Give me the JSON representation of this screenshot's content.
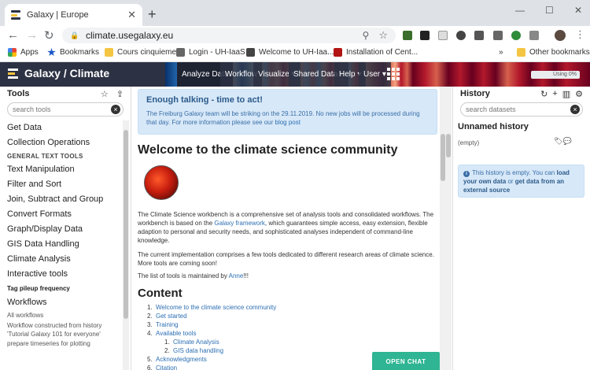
{
  "browser": {
    "tab_title": "Galaxy | Europe",
    "url": "climate.usegalaxy.eu",
    "bookmarks": [
      "Apps",
      "Bookmarks",
      "Cours cinquieme",
      "Login - UH-IaaS",
      "Welcome to UH-Iaa...",
      "Installation of Cent...",
      "»",
      "Other bookmarks"
    ]
  },
  "masthead": {
    "brand": "Galaxy / Climate",
    "nav": [
      "Analyze Data",
      "Workflow",
      "Visualize ▾",
      "Shared Data ▾",
      "Help ▾",
      "User ▾"
    ],
    "quota": "Using 0%"
  },
  "tools": {
    "title": "Tools",
    "search_placeholder": "search tools",
    "items": [
      {
        "label": "Get Data",
        "kind": "tool"
      },
      {
        "label": "Collection Operations",
        "kind": "tool"
      },
      {
        "label": "GENERAL TEXT TOOLS",
        "kind": "section"
      },
      {
        "label": "Text Manipulation",
        "kind": "tool"
      },
      {
        "label": "Filter and Sort",
        "kind": "tool"
      },
      {
        "label": "Join, Subtract and Group",
        "kind": "tool"
      },
      {
        "label": "Convert Formats",
        "kind": "tool"
      },
      {
        "label": "Graph/Display Data",
        "kind": "tool"
      },
      {
        "label": "GIS Data Handling",
        "kind": "tool"
      },
      {
        "label": "Climate Analysis",
        "kind": "tool"
      },
      {
        "label": "Interactive tools",
        "kind": "tool"
      },
      {
        "label": "Tag pileup frequency",
        "kind": "bold8"
      },
      {
        "label": "Workflows",
        "kind": "tool"
      },
      {
        "label": "All workflows",
        "kind": "small"
      },
      {
        "label": "Workflow constructed from history",
        "kind": "small2"
      },
      {
        "label": "'Tutorial Galaxy 101 for everyone'",
        "kind": "small2"
      },
      {
        "label": "prepare timeseries for plotting",
        "kind": "small"
      }
    ]
  },
  "center": {
    "alert_title": "Enough talking - time to act!",
    "alert_body_1": "The Freiburg Galaxy team will be striking on the 29.11.2019. No new jobs will be processed during that day. For more information please see our ",
    "alert_link": "blog post",
    "heading": "Welcome to the climate science community",
    "p1_a": "The Climate Science workbench is a comprehensive set of analysis tools and consolidated workflows. The workbench is based on the ",
    "p1_link": "Galaxy framework",
    "p1_b": ", which guarantees simple access, easy extension, flexible adaption to personal and security needs, and sophisticated analyses independent of command-line knowledge.",
    "p2": "The current implementation comprises a few tools dedicated to different research areas of climate science. More tools are coming soon!",
    "p3_a": "The list of tools is maintained by ",
    "p3_link": "Anne",
    "p3_b": "!!!",
    "content_heading": "Content",
    "toc": [
      {
        "n": "1.",
        "label": "Welcome to the climate science community",
        "level": 0
      },
      {
        "n": "2.",
        "label": "Get started",
        "level": 0
      },
      {
        "n": "3.",
        "label": "Training",
        "level": 0
      },
      {
        "n": "4.",
        "label": "Available tools",
        "level": 0
      },
      {
        "n": "1.",
        "label": "Climate Analysis",
        "level": 1
      },
      {
        "n": "2.",
        "label": "GIS data handling",
        "level": 1
      },
      {
        "n": "5.",
        "label": "Acknowledgments",
        "level": 0
      },
      {
        "n": "6.",
        "label": "Citation",
        "level": 0
      }
    ],
    "open_chat": "OPEN CHAT"
  },
  "history": {
    "title": "History",
    "search_placeholder": "search datasets",
    "name": "Unnamed history",
    "size": "(empty)",
    "info_a": "This history is empty. You can ",
    "info_link1": "load your own data",
    "info_b": " or ",
    "info_link2": "get data from an external source"
  }
}
